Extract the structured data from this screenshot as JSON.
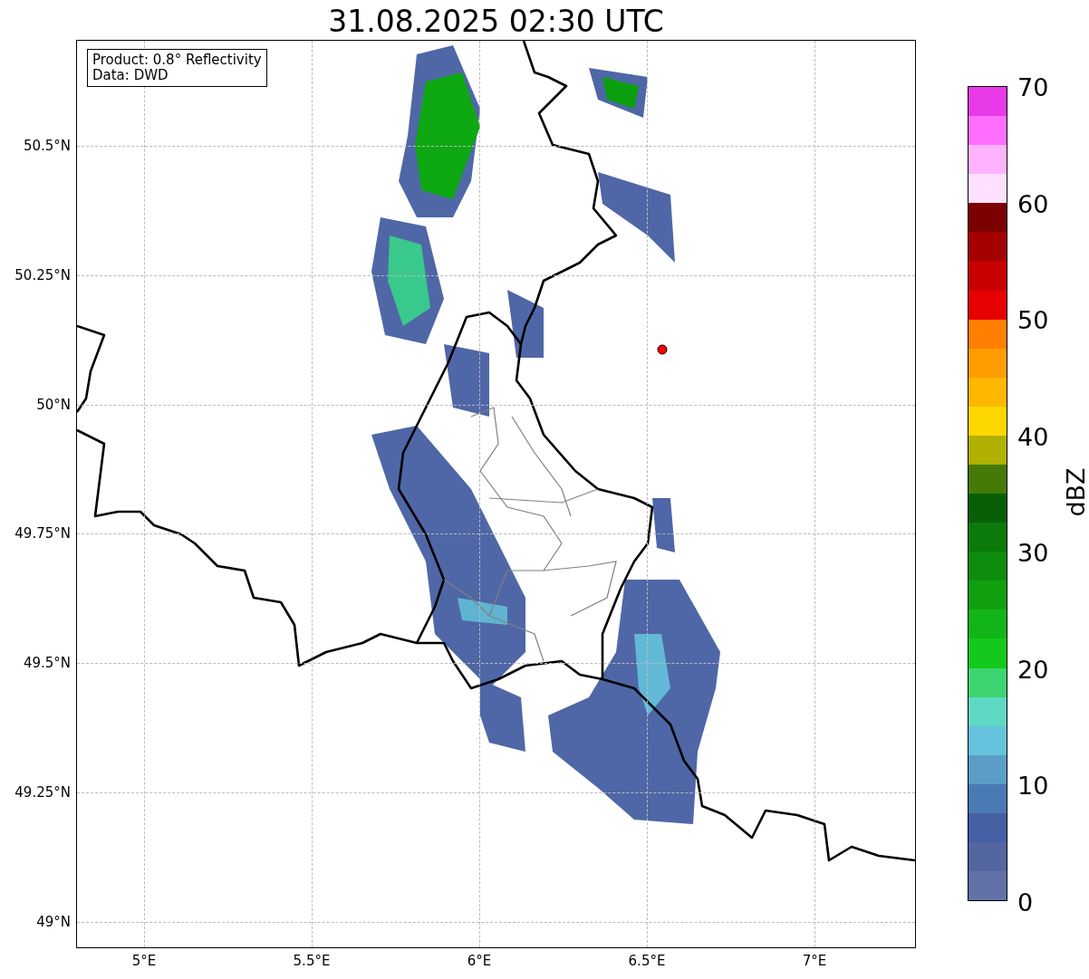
{
  "title": "31.08.2025 02:30 UTC",
  "info_box": [
    "Product: 0.8° Reflectivity",
    "Data: DWD"
  ],
  "map": {
    "xticks": [
      "5°E",
      "5.5°E",
      "6°E",
      "6.5°E",
      "7°E"
    ],
    "yticks": [
      "50.5°N",
      "50.25°N",
      "50°N",
      "49.75°N",
      "49.5°N",
      "49.25°N",
      "49°N"
    ]
  },
  "colorbar": {
    "label": "dBZ",
    "ticks": [
      "70",
      "60",
      "50",
      "40",
      "30",
      "20",
      "10",
      "0"
    ],
    "segments": [
      {
        "color": "#e83ae8"
      },
      {
        "color": "#ff6eff"
      },
      {
        "color": "#ffb3ff"
      },
      {
        "color": "#ffe0ff"
      },
      {
        "color": "#7c0000"
      },
      {
        "color": "#a50000"
      },
      {
        "color": "#c80000"
      },
      {
        "color": "#e60000"
      },
      {
        "color": "#ff7f00"
      },
      {
        "color": "#ff9c00"
      },
      {
        "color": "#ffb700"
      },
      {
        "color": "#ffd700"
      },
      {
        "color": "#b0b000"
      },
      {
        "color": "#467a08"
      },
      {
        "color": "#085f08"
      },
      {
        "color": "#0b7a0b"
      },
      {
        "color": "#0e8c0e"
      },
      {
        "color": "#10a010"
      },
      {
        "color": "#12b518"
      },
      {
        "color": "#13c91b"
      },
      {
        "color": "#3dd470"
      },
      {
        "color": "#5fd8c4"
      },
      {
        "color": "#66c2dc"
      },
      {
        "color": "#5a9ec8"
      },
      {
        "color": "#4a7ab5"
      },
      {
        "color": "#4560a5"
      },
      {
        "color": "#5366a0"
      },
      {
        "color": "#6272a8"
      }
    ]
  }
}
